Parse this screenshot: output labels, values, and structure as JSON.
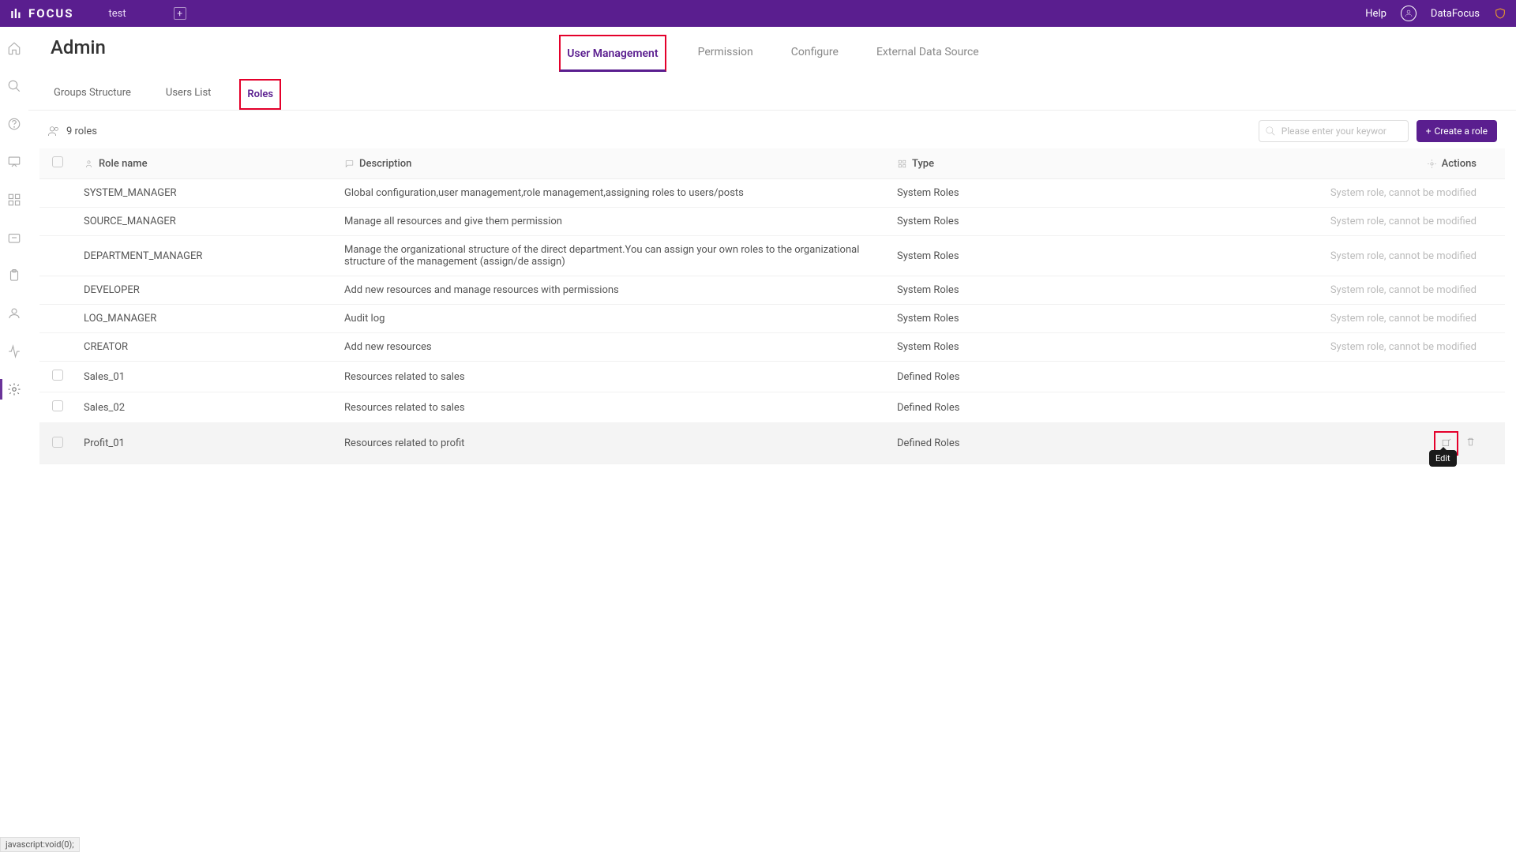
{
  "header": {
    "brand": "FOCUS",
    "workspace": "test",
    "help": "Help",
    "user": "DataFocus"
  },
  "page": {
    "title": "Admin"
  },
  "primaryTabs": [
    "User Management",
    "Permission",
    "Configure",
    "External Data Source"
  ],
  "primaryActive": 0,
  "secondaryTabs": [
    "Groups Structure",
    "Users List",
    "Roles"
  ],
  "secondaryActive": 2,
  "toolbar": {
    "count": "9 roles",
    "searchPlaceholder": "Please enter your keywor",
    "createBtn": "Create a role"
  },
  "columns": {
    "name": "Role name",
    "desc": "Description",
    "type": "Type",
    "actions": "Actions"
  },
  "systemActionText": "System role, cannot be modified",
  "tooltip": "Edit",
  "rows": [
    {
      "chk": false,
      "name": "SYSTEM_MANAGER",
      "desc": "Global configuration,user management,role management,assigning roles to users/posts",
      "type": "System Roles",
      "sys": true
    },
    {
      "chk": false,
      "name": "SOURCE_MANAGER",
      "desc": "Manage all resources and give them permission",
      "type": "System Roles",
      "sys": true
    },
    {
      "chk": false,
      "name": "DEPARTMENT_MANAGER",
      "desc": "Manage the organizational structure of the direct department.You can assign your own roles to the organizational structure of the management (assign/de assign)",
      "type": "System Roles",
      "sys": true
    },
    {
      "chk": false,
      "name": "DEVELOPER",
      "desc": "Add new resources and manage resources with permissions",
      "type": "System Roles",
      "sys": true
    },
    {
      "chk": false,
      "name": "LOG_MANAGER",
      "desc": "Audit log",
      "type": "System Roles",
      "sys": true
    },
    {
      "chk": false,
      "name": "CREATOR",
      "desc": "Add new resources",
      "type": "System Roles",
      "sys": true
    },
    {
      "chk": true,
      "name": "Sales_01",
      "desc": "Resources related to sales",
      "type": "Defined Roles",
      "sys": false
    },
    {
      "chk": true,
      "name": "Sales_02",
      "desc": "Resources related to sales",
      "type": "Defined Roles",
      "sys": false
    },
    {
      "chk": true,
      "name": "Profit_01",
      "desc": "Resources related to profit",
      "type": "Defined Roles",
      "sys": false,
      "hover": true
    }
  ],
  "statusbar": "javascript:void(0);"
}
